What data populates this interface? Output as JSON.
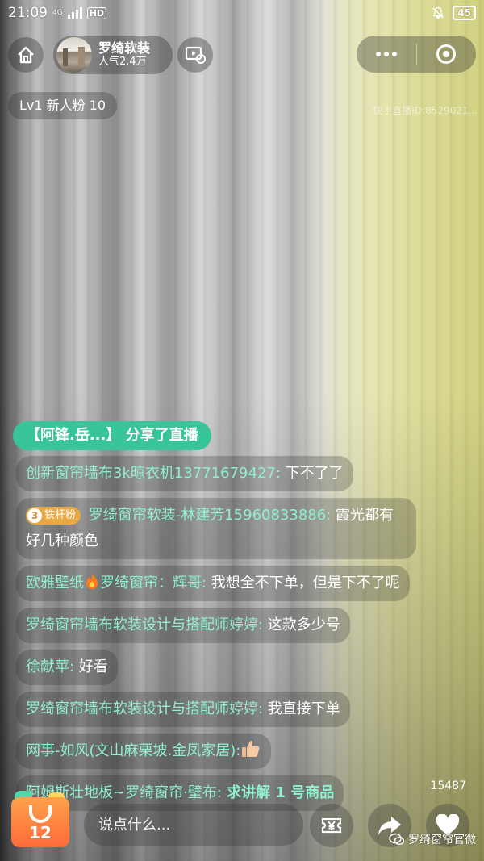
{
  "status_bar": {
    "time": "21:09",
    "network": "4G",
    "hd_label": "HD",
    "battery": "45"
  },
  "header": {
    "anchor_name": "罗绮软装",
    "popularity": "人气2.4万"
  },
  "fan_badge": "Lv1 新人粉 10",
  "live_id": "快手直播ID:8529021...",
  "share_banner": "【阿锋.岳...】 分享了直播",
  "chat": [
    {
      "user": "创新窗帘墙布3k晾衣机13771679427:",
      "text": " 下不了了"
    },
    {
      "medal_level": "3",
      "medal_label": "铁杆粉",
      "user": " 罗绮窗帘软装-林建芳15960833886:",
      "text": " 霞光都有好几种颜色"
    },
    {
      "user_prefix": "欧雅壁纸",
      "user": "罗绮窗帘：辉哥:",
      "text": " 我想全不下单，但是下不了呢"
    },
    {
      "user": "罗绮窗帘墙布软装设计与搭配师婷婷:",
      "text": " 这款多少号"
    },
    {
      "user": "徐献苹:",
      "text": " 好看"
    },
    {
      "user": "罗绮窗帘墙布软装设计与搭配师婷婷:",
      "text": " 我直接下单"
    },
    {
      "user": "网事-如风(文山麻栗坡.金凤家居):",
      "text": ""
    },
    {
      "user": "阿姆斯壮地板~罗绮窗帘·壁布:",
      "text": " 求讲解 1 号商品"
    }
  ],
  "bottom": {
    "cart_count": "12",
    "comment_placeholder": "说点什么...",
    "like_count": "15487",
    "watermark": "罗绮窗帘官微"
  },
  "colors": {
    "username": "#8ff0cf",
    "share_banner_bg": "#39c59a",
    "medal_bg": "#e6a945",
    "cart_orange": "#ff6a3a"
  },
  "icons": [
    "home-icon",
    "video-icon",
    "more-dots-icon",
    "close-target-icon",
    "bell-off-icon",
    "fire-icon",
    "thumbs-up-icon",
    "cart-bag-icon",
    "reward-icon",
    "share-icon",
    "heart-icon",
    "wechat-icon"
  ]
}
